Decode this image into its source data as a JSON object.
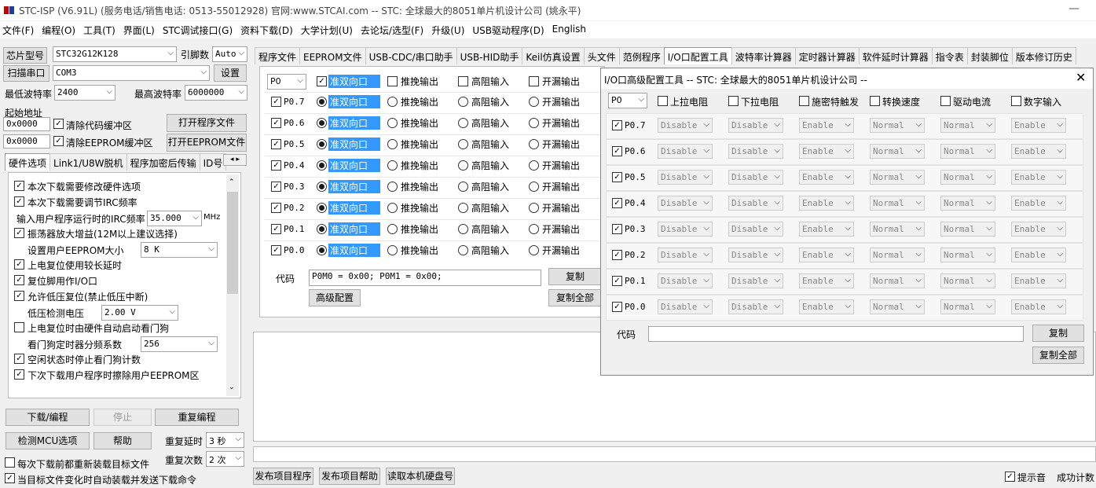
{
  "window": {
    "title": "STC-ISP (V6.91L) (服务电话/销售电话: 0513-55012928) 官网:www.STCAI.com  -- STC: 全球最大的8051单片机设计公司 (姚永平)"
  },
  "menu": [
    "文件(F)",
    "编程(O)",
    "工具(T)",
    "界面(L)",
    "STC调试接口(G)",
    "资料下载(D)",
    "大学计划(U)",
    "去论坛/选型(F)",
    "升级(U)",
    "USB驱动程序(D)",
    "English"
  ],
  "left": {
    "chip_label": "芯片型号",
    "chip_value": "STC32G12K128",
    "pin_label": "引脚数",
    "pin_value": "Auto",
    "scan_label": "扫描串口",
    "port_value": "COM3",
    "settings_label": "设置",
    "min_baud_label": "最低波特率",
    "min_baud": "2400",
    "max_baud_label": "最高波特率",
    "max_baud": "6000000",
    "start_addr_label": "起始地址",
    "addr1": "0x0000",
    "clear_code": "清除代码缓冲区",
    "open_prog": "打开程序文件",
    "addr2": "0x0000",
    "clear_eeprom": "清除EEPROM缓冲区",
    "open_eeprom": "打开EEPROM文件",
    "tabs": [
      "硬件选项",
      "Link1/U8W脱机",
      "程序加密后传输",
      "ID号"
    ],
    "options": [
      {
        "label": "本次下载需要修改硬件选项",
        "checked": true
      },
      {
        "label": "本次下载需要调节IRC频率",
        "checked": true
      },
      {
        "label": "输入用户程序运行时的IRC频率",
        "value": "35.000",
        "unit": "MHz"
      },
      {
        "label": "振荡器放大增益(12M以上建议选择)",
        "checked": true
      },
      {
        "label": "设置用户EEPROM大小",
        "value": "8    K"
      },
      {
        "label": "上电复位使用较长延时",
        "checked": true
      },
      {
        "label": "复位脚用作I/O口",
        "checked": true
      },
      {
        "label": "允许低压复位(禁止低压中断)",
        "checked": true
      },
      {
        "label": "低压检测电压",
        "value": "2.00 V"
      },
      {
        "label": "上电复位时由硬件自动启动看门狗",
        "checked": false
      },
      {
        "label": "看门狗定时器分频系数",
        "value": "256"
      },
      {
        "label": "空闲状态时停止看门狗计数",
        "checked": true
      },
      {
        "label": "下次下载用户程序时擦除用户EEPROM区",
        "checked": true
      }
    ],
    "download_btn": "下载/编程",
    "stop_btn": "停止",
    "reprogram_btn": "重复编程",
    "detect_btn": "检测MCU选项",
    "help_btn": "帮助",
    "repeat_delay_label": "重复延时",
    "repeat_delay": "3 秒",
    "repeat_count_label": "重复次数",
    "repeat_count": "2 次",
    "reload_each": "每次下载前都重新装载目标文件",
    "auto_reload": "当目标文件变化时自动装载并发送下载命令"
  },
  "main_tabs": [
    "程序文件",
    "EEPROM文件",
    "USB-CDC/串口助手",
    "USB-HID助手",
    "Keil仿真设置",
    "头文件",
    "范例程序",
    "I/O口配置工具",
    "波特率计算器",
    "定时器计算器",
    "软件延时计算器",
    "指令表",
    "封装脚位",
    "版本修订历史"
  ],
  "io": {
    "port": "P0",
    "modes": [
      "准双向口",
      "推挽输出",
      "高阻输入",
      "开漏输出"
    ],
    "pins": [
      "P0.7",
      "P0.6",
      "P0.5",
      "P0.4",
      "P0.3",
      "P0.2",
      "P0.1",
      "P0.0"
    ],
    "code_label": "代码",
    "code_value": "P0M0 = 0x00; P0M1 = 0x00;",
    "copy": "复制",
    "copy_all": "复制全部",
    "advanced": "高级配置"
  },
  "dialog": {
    "title": "I/O口高级配置工具 -- STC: 全球最大的8051单片机设计公司 --",
    "port": "P0",
    "headers": [
      "上拉电阻",
      "下拉电阻",
      "施密特触发",
      "转换速度",
      "驱动电流",
      "数字输入"
    ],
    "values": [
      "Disable",
      "Disable",
      "Enable",
      "Normal",
      "Normal",
      "Enable"
    ],
    "pins": [
      "P0.7",
      "P0.6",
      "P0.5",
      "P0.4",
      "P0.3",
      "P0.2",
      "P0.1",
      "P0.0"
    ],
    "code_label": "代码",
    "copy": "复制",
    "copy_all": "复制全部"
  },
  "bottom": {
    "publish_prog": "发布项目程序",
    "publish_help": "发布项目帮助",
    "read_disk": "读取本机硬盘号",
    "tips": "提示音",
    "success": "成功计数"
  }
}
